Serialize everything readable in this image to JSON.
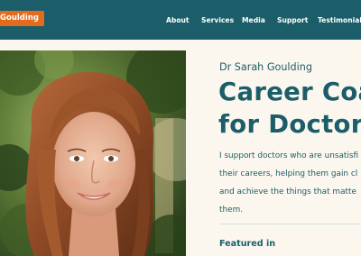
{
  "header": {
    "logo_text": "Goulding",
    "nav": [
      {
        "label": "About"
      },
      {
        "label": "Services"
      },
      {
        "label": "Media"
      },
      {
        "label": "Support"
      },
      {
        "label": "Testimonials"
      }
    ]
  },
  "hero": {
    "subtitle": "Dr Sarah Goulding",
    "headline_lines": [
      "Career Coac",
      "for Doctors"
    ],
    "intro_lines": [
      "I support doctors who are unsatisfi",
      "their careers, helping them gain cl",
      "and achieve the things that matte",
      "them."
    ],
    "featured_label": "Featured in"
  },
  "colors": {
    "header_bg": "#1b5e69",
    "logo_bg": "#e46a1c",
    "page_bg": "#fbf6ee",
    "text_primary": "#1b5e69"
  }
}
